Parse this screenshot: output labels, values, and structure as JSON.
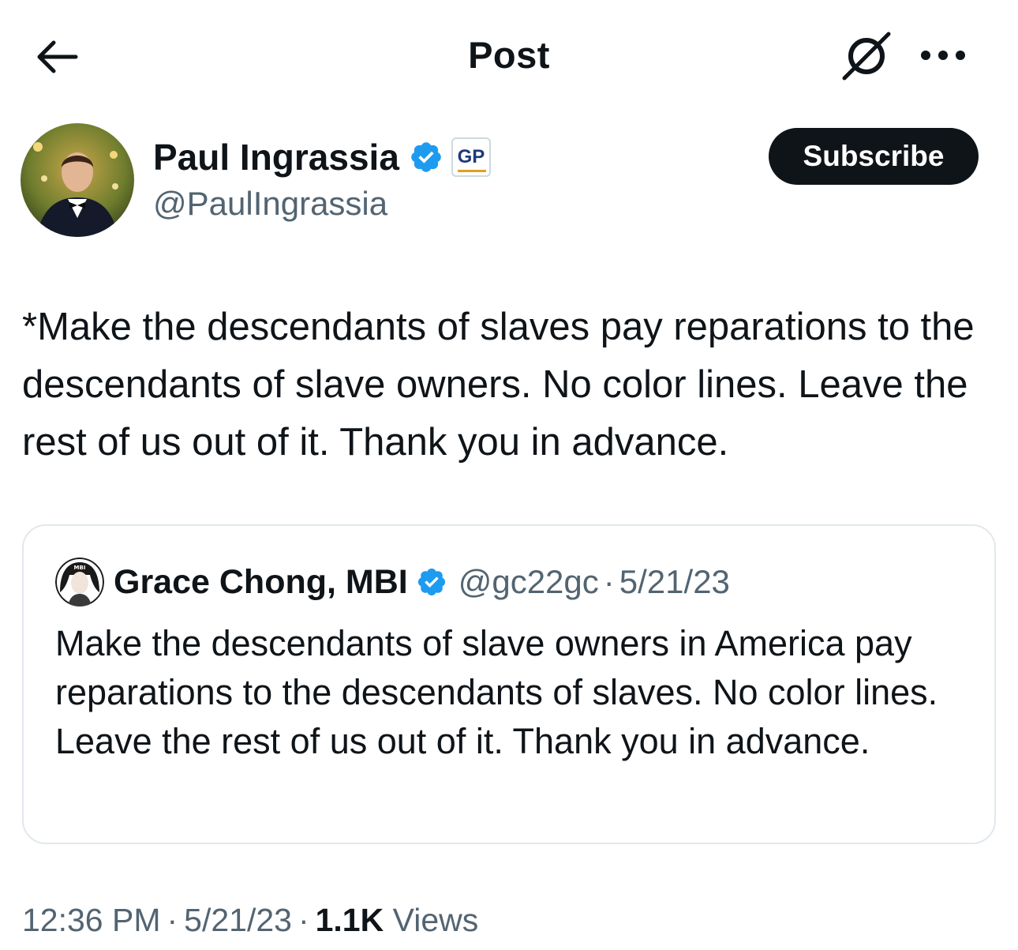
{
  "header": {
    "title": "Post",
    "back_icon": "arrow-left-icon",
    "grok_icon": "grok-icon",
    "more_icon": "more-horizontal-icon"
  },
  "author": {
    "name": "Paul Ingrassia",
    "handle": "@PaulIngrassia",
    "verified_icon": "verified-badge-icon",
    "affiliate_badge": "GP",
    "subscribe_label": "Subscribe"
  },
  "post": {
    "text": "*Make the descendants of slaves pay reparations to the descendants of slave owners. No color lines. Leave the rest of us out of it. Thank you in advance."
  },
  "quote": {
    "name": "Grace Chong, MBI",
    "handle": "@gc22gc",
    "separator": "·",
    "date": "5/21/23",
    "text": "Make the descendants of slave owners in America pay reparations to the descendants of slaves. No color lines. Leave the rest of us out of it. Thank you in advance.",
    "avatar_text": "MBI"
  },
  "meta": {
    "time": "12:36 PM",
    "separator": "·",
    "date": "5/21/23",
    "views_count": "1.1K",
    "views_label": "Views"
  },
  "colors": {
    "text_primary": "#0f1419",
    "text_secondary": "#536471",
    "verified_blue": "#1d9bf0",
    "border": "#e1e8ed",
    "button_bg": "#0f1419"
  }
}
